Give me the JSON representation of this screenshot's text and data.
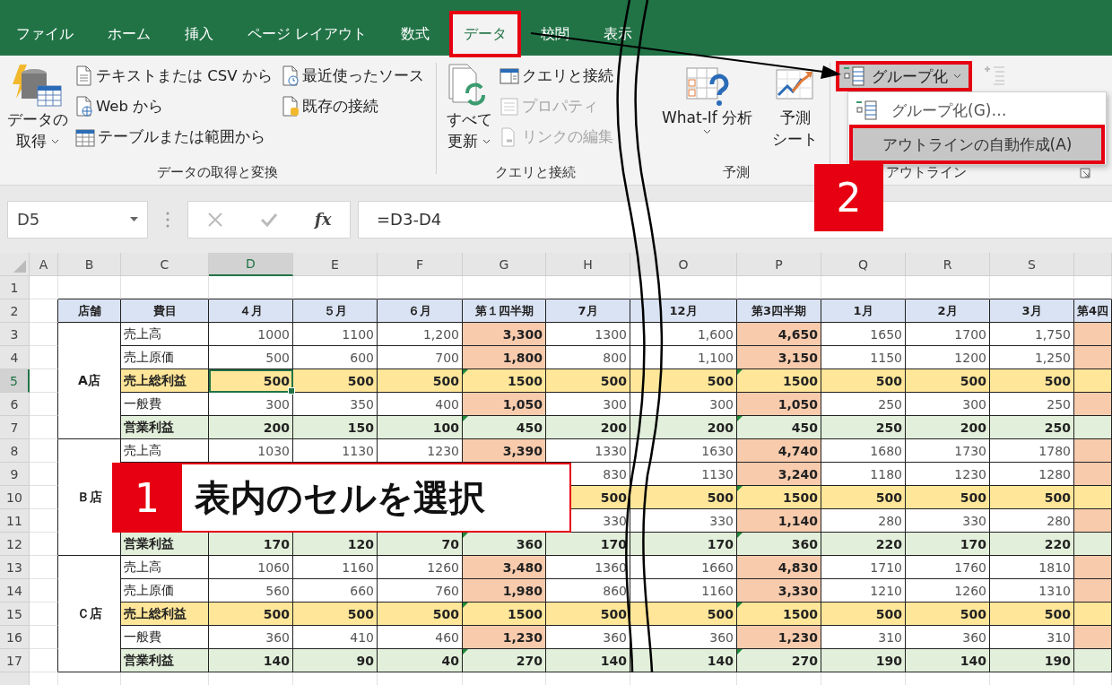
{
  "tabs": [
    {
      "label": "ファイル",
      "selected": false,
      "highlighted": false
    },
    {
      "label": "ホーム",
      "selected": false,
      "highlighted": false
    },
    {
      "label": "挿入",
      "selected": false,
      "highlighted": false
    },
    {
      "label": "ページ レイアウト",
      "selected": false,
      "highlighted": false
    },
    {
      "label": "数式",
      "selected": false,
      "highlighted": false
    },
    {
      "label": "データ",
      "selected": true,
      "highlighted": true
    },
    {
      "label": "校閲",
      "selected": false,
      "highlighted": false
    },
    {
      "label": "表示",
      "selected": false,
      "highlighted": false
    }
  ],
  "get_data": {
    "label": "データの取得と変換",
    "button": [
      "データの",
      "取得"
    ],
    "items": [
      {
        "label": "テキストまたは CSV から",
        "kind": "text"
      },
      {
        "label": "Web から",
        "kind": "web"
      },
      {
        "label": "テーブルまたは範囲から",
        "kind": "table"
      },
      {
        "label": "最近使ったソース",
        "kind": "recent"
      },
      {
        "label": "既存の接続",
        "kind": "connection"
      }
    ]
  },
  "queries": {
    "label": "クエリと接続",
    "button": [
      "すべて",
      "更新"
    ],
    "items": [
      {
        "label": "クエリと接続",
        "kind": "queries",
        "disabled": false
      },
      {
        "label": "プロパティ",
        "kind": "properties",
        "disabled": true
      },
      {
        "label": "リンクの編集",
        "kind": "links",
        "disabled": true
      }
    ]
  },
  "forecast": {
    "label": "予測",
    "buttons": [
      {
        "kind": "whatif",
        "lines": [
          "What-If 分析"
        ],
        "dropdown": true
      },
      {
        "kind": "sheet",
        "lines": [
          "予測",
          "シート"
        ],
        "dropdown": false
      }
    ]
  },
  "outline": {
    "label": "アウトライン",
    "group_button": {
      "label": "グループ化",
      "highlighted": true
    },
    "ungroup": {
      "disabled": true
    },
    "menu": [
      {
        "label": "グループ化(G)…",
        "selected": false,
        "highlighted": false
      },
      {
        "label": "アウトラインの自動作成(A)",
        "selected": true,
        "highlighted": true
      }
    ]
  },
  "formula_bar": {
    "name_box": "D5",
    "fx": "fx",
    "formula": "=D3-D4"
  },
  "columns": [
    {
      "letter": "A",
      "selected": false
    },
    {
      "letter": "B",
      "selected": false
    },
    {
      "letter": "C",
      "selected": false
    },
    {
      "letter": "D",
      "kind": "month",
      "selected": true
    },
    {
      "letter": "E",
      "kind": "month",
      "selected": false
    },
    {
      "letter": "F",
      "kind": "month",
      "selected": false
    },
    {
      "letter": "G",
      "kind": "quarter",
      "selected": false
    },
    {
      "letter": "H",
      "kind": "month",
      "selected": false
    },
    {
      "letter": "O",
      "kind": "month",
      "selected": false
    },
    {
      "letter": "P",
      "kind": "quarter",
      "selected": false
    },
    {
      "letter": "Q",
      "kind": "month",
      "selected": false
    },
    {
      "letter": "R",
      "kind": "month",
      "selected": false
    },
    {
      "letter": "S",
      "kind": "month",
      "selected": false
    },
    {
      "kind": "quarter",
      "selected": false
    }
  ],
  "blank_row": {
    "number": "1",
    "selected": false
  },
  "header_row": {
    "number": "2",
    "selected": false,
    "cells": [
      "店舗",
      "費目",
      "４月",
      "５月",
      "６月",
      "第１四半期",
      "7月",
      "12月",
      "第3四半期",
      "1月",
      "2月",
      "3月",
      "第4四"
    ]
  },
  "blocks": [
    {
      "store": "A店",
      "rows": [
        {
          "number": "3",
          "kind": "sales",
          "selected": false,
          "covered": false,
          "label": "売上高",
          "values": [
            "1000",
            "1100",
            "1,200",
            "3,300",
            "1300",
            "1,600",
            "4,650",
            "1650",
            "1700",
            "1,750"
          ]
        },
        {
          "number": "4",
          "kind": "cost",
          "selected": false,
          "covered": false,
          "label": "売上原価",
          "values": [
            "500",
            "600",
            "700",
            "1,800",
            "800",
            "1,100",
            "3,150",
            "1150",
            "1200",
            "1,250"
          ]
        },
        {
          "number": "5",
          "kind": "gross",
          "selected": true,
          "covered": false,
          "label": "売上総利益",
          "values": [
            "500",
            "500",
            "500",
            "1500",
            "500",
            "500",
            "1500",
            "500",
            "500",
            "500"
          ]
        },
        {
          "number": "6",
          "kind": "expense",
          "selected": false,
          "covered": false,
          "label": "一般費",
          "values": [
            "300",
            "350",
            "400",
            "1,050",
            "300",
            "300",
            "1,050",
            "250",
            "300",
            "250"
          ]
        },
        {
          "number": "7",
          "kind": "operating",
          "selected": false,
          "covered": false,
          "label": "営業利益",
          "values": [
            "200",
            "150",
            "100",
            "450",
            "200",
            "200",
            "450",
            "250",
            "200",
            "250"
          ]
        }
      ]
    },
    {
      "store": "Ｂ店",
      "rows": [
        {
          "number": "8",
          "kind": "sales",
          "selected": false,
          "covered": false,
          "label": "売上高",
          "values": [
            "1030",
            "1130",
            "1230",
            "3,390",
            "1330",
            "1630",
            "4,740",
            "1680",
            "1730",
            "1780"
          ]
        },
        {
          "number": "9",
          "kind": "cost",
          "selected": false,
          "covered": true,
          "values": [
            "830",
            "1130",
            "3,240",
            "1180",
            "1230",
            "1280"
          ]
        },
        {
          "number": "10",
          "kind": "gross",
          "selected": false,
          "covered": true,
          "values": [
            "500",
            "500",
            "1500",
            "500",
            "500",
            "500"
          ]
        },
        {
          "number": "11",
          "kind": "expense",
          "selected": false,
          "covered": true,
          "values": [
            "330",
            "330",
            "1,140",
            "280",
            "330",
            "280"
          ]
        },
        {
          "number": "12",
          "kind": "operating",
          "selected": false,
          "covered": false,
          "label": "営業利益",
          "values": [
            "170",
            "120",
            "70",
            "360",
            "170",
            "170",
            "360",
            "220",
            "170",
            "220"
          ]
        }
      ]
    },
    {
      "store": "Ｃ店",
      "rows": [
        {
          "number": "13",
          "kind": "sales",
          "selected": false,
          "covered": false,
          "label": "売上高",
          "values": [
            "1060",
            "1160",
            "1260",
            "3,480",
            "1360",
            "1660",
            "4,830",
            "1710",
            "1760",
            "1810"
          ]
        },
        {
          "number": "14",
          "kind": "cost",
          "selected": false,
          "covered": false,
          "label": "売上原価",
          "values": [
            "560",
            "660",
            "760",
            "1,980",
            "860",
            "1160",
            "3,330",
            "1210",
            "1260",
            "1310"
          ]
        },
        {
          "number": "15",
          "kind": "gross",
          "selected": false,
          "covered": false,
          "label": "売上総利益",
          "values": [
            "500",
            "500",
            "500",
            "1500",
            "500",
            "500",
            "1500",
            "500",
            "500",
            "500"
          ]
        },
        {
          "number": "16",
          "kind": "expense",
          "selected": false,
          "covered": false,
          "label": "一般費",
          "values": [
            "360",
            "410",
            "460",
            "1,230",
            "360",
            "360",
            "1,230",
            "310",
            "360",
            "310"
          ]
        },
        {
          "number": "17",
          "kind": "operating",
          "selected": false,
          "covered": false,
          "label": "営業利益",
          "values": [
            "140",
            "90",
            "40",
            "270",
            "140",
            "140",
            "270",
            "190",
            "140",
            "190"
          ]
        }
      ]
    }
  ],
  "steps": [
    {
      "number": "1",
      "text": "表内のセルを選択"
    },
    {
      "number": "2"
    }
  ]
}
